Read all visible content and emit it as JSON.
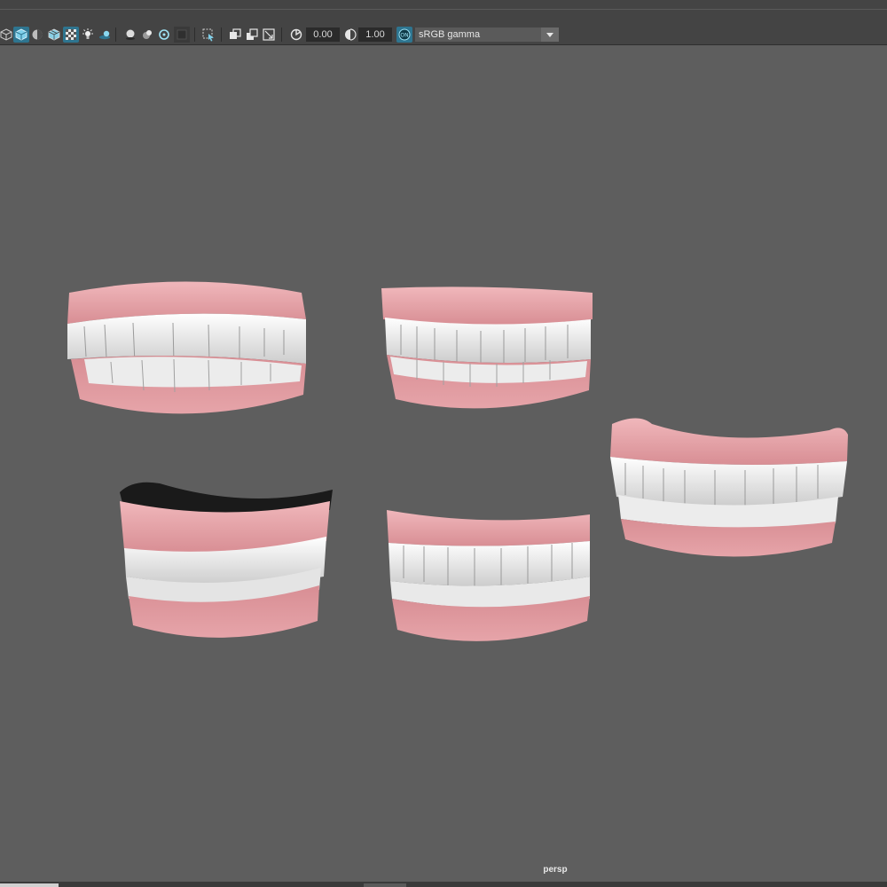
{
  "toolbar": {
    "icons": [
      "wireframe-cube-icon",
      "smooth-shade-cube-icon",
      "default-material-icon",
      "textured-icon",
      "xray-checker-icon",
      "lights-icon",
      "shadows-icon",
      "ambient-occlusion-icon",
      "antialias-icon",
      "depth-of-field-icon",
      "motion-blur-icon",
      "isolate-select-icon",
      "xray-icon",
      "xray-joints-icon",
      "xray-active-icon",
      "exposure-icon",
      "gamma-icon",
      "color-management-icon"
    ],
    "exposure_value": "0.00",
    "gamma_value": "1.00",
    "color_space": "sRGB gamma",
    "colors": {
      "bar": "#444444",
      "highlight": "#2e7590",
      "field": "#2b2b2b"
    }
  },
  "viewport": {
    "background": "#5e5e5e",
    "camera": "persp",
    "models": [
      "teeth-model-1",
      "teeth-model-2",
      "teeth-model-3",
      "teeth-model-4",
      "teeth-model-5"
    ],
    "colors": {
      "gum": "#e3a0a5",
      "gum_dark": "#c98287",
      "tooth": "#f2f2f2",
      "tooth_shade": "#cfcfcf"
    }
  }
}
